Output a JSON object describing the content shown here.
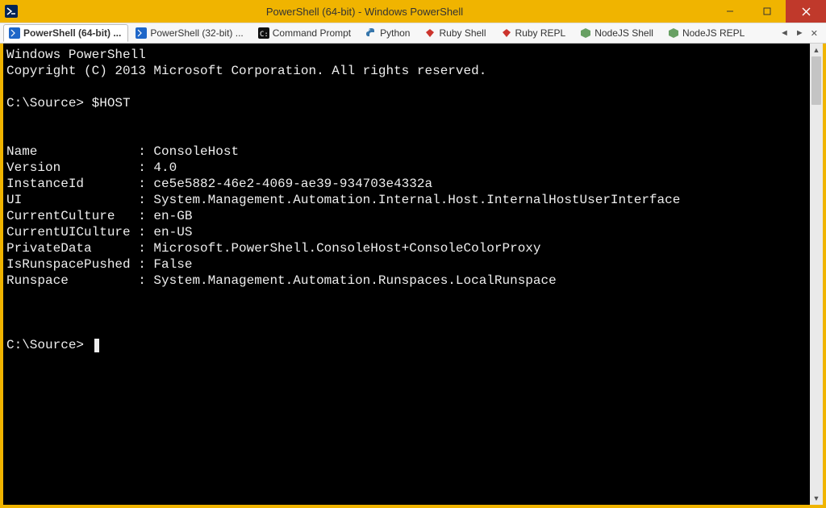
{
  "window": {
    "title": "PowerShell (64-bit) - Windows PowerShell"
  },
  "tabs": [
    {
      "label": "PowerShell (64-bit) ...",
      "icon": "ps-blue",
      "active": true
    },
    {
      "label": "PowerShell (32-bit) ...",
      "icon": "ps-blue",
      "active": false
    },
    {
      "label": "Command Prompt",
      "icon": "cmd",
      "active": false
    },
    {
      "label": "Python",
      "icon": "py",
      "active": false
    },
    {
      "label": "Ruby Shell",
      "icon": "ruby",
      "active": false
    },
    {
      "label": "Ruby REPL",
      "icon": "ruby",
      "active": false
    },
    {
      "label": "NodeJS Shell",
      "icon": "node",
      "active": false
    },
    {
      "label": "NodeJS REPL",
      "icon": "node",
      "active": false
    }
  ],
  "terminal": {
    "header_line1": "Windows PowerShell",
    "header_line2": "Copyright (C) 2013 Microsoft Corporation. All rights reserved.",
    "prompt1": "C:\\Source>",
    "command1": "$HOST",
    "prompt2": "C:\\Source>",
    "kv": [
      {
        "k": "Name",
        "v": "ConsoleHost"
      },
      {
        "k": "Version",
        "v": "4.0"
      },
      {
        "k": "InstanceId",
        "v": "ce5e5882-46e2-4069-ae39-934703e4332a"
      },
      {
        "k": "UI",
        "v": "System.Management.Automation.Internal.Host.InternalHostUserInterface"
      },
      {
        "k": "CurrentCulture",
        "v": "en-GB"
      },
      {
        "k": "CurrentUICulture",
        "v": "en-US"
      },
      {
        "k": "PrivateData",
        "v": "Microsoft.PowerShell.ConsoleHost+ConsoleColorProxy"
      },
      {
        "k": "IsRunspacePushed",
        "v": "False"
      },
      {
        "k": "Runspace",
        "v": "System.Management.Automation.Runspaces.LocalRunspace"
      }
    ]
  },
  "tab_controls": {
    "left": "◄",
    "right": "►",
    "close": "✕"
  }
}
